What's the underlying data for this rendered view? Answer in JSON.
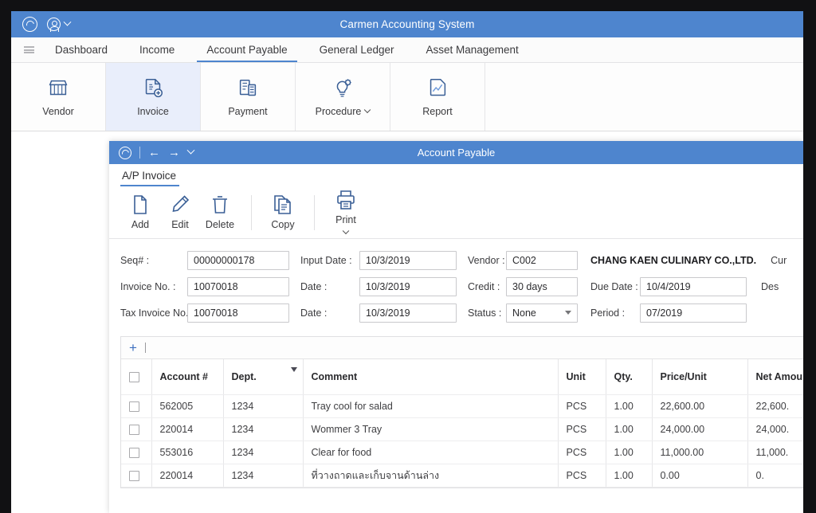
{
  "app": {
    "title": "Carmen Accounting System",
    "logo_icon": "swirl-logo-icon",
    "user_icon": "user-account-icon",
    "user_chevron_icon": "chevron-down-icon",
    "accent_color": "#4e85ce",
    "selected_tile_bg": "#e9eefb"
  },
  "nav": {
    "menu_icon": "hamburger-menu-icon",
    "items": [
      {
        "label": "Dashboard",
        "active": false
      },
      {
        "label": "Income",
        "active": false
      },
      {
        "label": "Account Payable",
        "active": true
      },
      {
        "label": "General Ledger",
        "active": false
      },
      {
        "label": "Asset Management",
        "active": false
      }
    ]
  },
  "ribbon": {
    "buttons": [
      {
        "label": "Vendor",
        "icon": "storefront-icon",
        "selected": false,
        "has_chevron": false
      },
      {
        "label": "Invoice",
        "icon": "invoice-document-icon",
        "selected": true,
        "has_chevron": false
      },
      {
        "label": "Payment",
        "icon": "payment-calculator-icon",
        "selected": false,
        "has_chevron": false
      },
      {
        "label": "Procedure",
        "icon": "lightbulb-gear-icon",
        "selected": false,
        "has_chevron": true
      },
      {
        "label": "Report",
        "icon": "report-chart-icon",
        "selected": false,
        "has_chevron": false
      }
    ]
  },
  "child_window": {
    "title": "Account Payable",
    "logo_icon": "swirl-logo-icon",
    "back_icon": "arrow-left-icon",
    "forward_icon": "arrow-right-icon",
    "more_icon": "chevron-down-icon",
    "tab_label": "A/P Invoice",
    "toolbar": [
      {
        "label": "Add",
        "icon": "new-document-icon",
        "has_chevron": false
      },
      {
        "label": "Edit",
        "icon": "pencil-icon",
        "has_chevron": false
      },
      {
        "label": "Delete",
        "icon": "trash-can-icon",
        "has_chevron": false
      },
      {
        "label": "Copy",
        "icon": "copy-pages-icon",
        "has_chevron": false
      },
      {
        "label": "Print",
        "icon": "printer-icon",
        "has_chevron": true
      }
    ]
  },
  "form": {
    "rows": [
      {
        "f1_label": "Seq# :",
        "f1_value": "00000000178",
        "f2_label": "Input Date :",
        "f2_value": "10/3/2019",
        "f3_label": "Vendor :",
        "f3_value": "C002",
        "extra_text": "CHANG KAEN CULINARY CO.,LTD.",
        "f4_label": "Cur"
      },
      {
        "f1_label": "Invoice No. :",
        "f1_value": "10070018",
        "f2_label": "Date :",
        "f2_value": "10/3/2019",
        "f3_label": "Credit :",
        "f3_value": "30 days",
        "f4_label": "Due Date :",
        "f4_value": "10/4/2019",
        "f5_label": "Des"
      },
      {
        "f1_label": "Tax Invoice No. :",
        "f1_value": "10070018",
        "f2_label": "Date :",
        "f2_value": "10/3/2019",
        "f3_label": "Status :",
        "f3_value": "None",
        "f3_is_select": true,
        "f4_label": "Period :",
        "f4_value": "07/2019"
      }
    ]
  },
  "grid": {
    "add_icon": "plus-icon",
    "select_all_checkbox": "checkbox-unchecked",
    "filter_icon": "filter-funnel-icon",
    "columns": [
      {
        "label": "",
        "key": "cb"
      },
      {
        "label": "Account #",
        "key": "account"
      },
      {
        "label": "Dept.",
        "key": "dept"
      },
      {
        "label": "Comment",
        "key": "comment"
      },
      {
        "label": "Unit",
        "key": "unit"
      },
      {
        "label": "Qty.",
        "key": "qty"
      },
      {
        "label": "Price/Unit",
        "key": "price"
      },
      {
        "label": "Net Amount",
        "key": "net"
      }
    ],
    "rows": [
      {
        "account": "562005",
        "dept": "1234",
        "comment": "Tray cool for salad",
        "unit": "PCS",
        "qty": "1.00",
        "price": "22,600.00",
        "net": "22,600."
      },
      {
        "account": "220014",
        "dept": "1234",
        "comment": "Wommer 3 Tray",
        "unit": "PCS",
        "qty": "1.00",
        "price": "24,000.00",
        "net": "24,000."
      },
      {
        "account": "553016",
        "dept": "1234",
        "comment": "Clear for food",
        "unit": "PCS",
        "qty": "1.00",
        "price": "11,000.00",
        "net": "11,000."
      },
      {
        "account": "220014",
        "dept": "1234",
        "comment": "ที่วางถาดและเก็บจานด้านล่าง",
        "unit": "PCS",
        "qty": "1.00",
        "price": "0.00",
        "net": "0."
      }
    ]
  }
}
